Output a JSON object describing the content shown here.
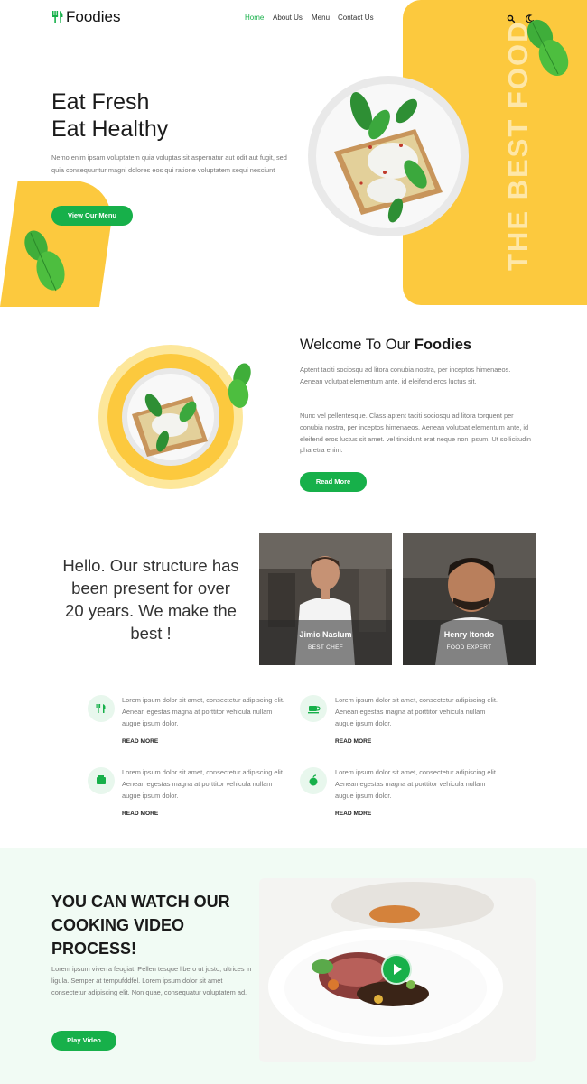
{
  "header": {
    "logo": "Foodies",
    "nav": [
      "Home",
      "About Us",
      "Menu",
      "Contact Us"
    ],
    "search_icon": "search-icon",
    "theme_icon": "moon-icon"
  },
  "hero": {
    "title_line1": "Eat Fresh",
    "title_line2": "Eat Healthy",
    "body": "Nemo enim ipsam voluptatem quia voluptas sit aspernatur aut odit aut fugit, sed quia consequuntur magni dolores eos qui ratione voluptatem sequi nesciunt",
    "button": "View Our Menu",
    "vertical_text": "THE BEST FOOD"
  },
  "welcome": {
    "title_prefix": "Welcome To Our ",
    "title_bold": "Foodies",
    "p1": "Aptent taciti sociosqu ad litora conubia nostra, per inceptos himenaeos. Aenean volutpat elementum ante, id eleifend eros luctus sit.",
    "p2": "Nunc vel pellentesque. Class aptent taciti sociosqu ad litora torquent per conubia nostra, per inceptos himenaeos. Aenean volutpat elementum ante, id eleifend eros luctus sit amet. vel tincidunt erat neque non ipsum. Ut sollicitudin pharetra enim.",
    "button": "Read More"
  },
  "about": {
    "hello": "Hello. Our structure has been present for over 20 years. We make the best !",
    "chefs": [
      {
        "name": "Jimic Naslum",
        "role": "BEST CHEF"
      },
      {
        "name": "Henry Itondo",
        "role": "FOOD EXPERT"
      }
    ]
  },
  "features": [
    {
      "icon": "utensils-icon",
      "text": "Lorem ipsum dolor sit amet, consectetur adipiscing elit. Aenean egestas magna at porttitor vehicula nullam augue ipsum dolor.",
      "link": "READ MORE"
    },
    {
      "icon": "coffee-cup-icon",
      "text": "Lorem ipsum dolor sit amet, consectetur adipiscing elit. Aenean egestas magna at porttitor vehicula nullam augue ipsum dolor.",
      "link": "READ MORE"
    },
    {
      "icon": "food-box-icon",
      "text": "Lorem ipsum dolor sit amet, consectetur adipiscing elit. Aenean egestas magna at porttitor vehicula nullam augue ipsum dolor.",
      "link": "READ MORE"
    },
    {
      "icon": "apple-icon",
      "text": "Lorem ipsum dolor sit amet, consectetur adipiscing elit. Aenean egestas magna at porttitor vehicula nullam augue ipsum dolor.",
      "link": "READ MORE"
    }
  ],
  "video": {
    "title": "YOU CAN WATCH OUR COOKING VIDEO PROCESS!",
    "body": "Lorem ipsum viverra feugiat. Pellen tesque libero ut justo, ultrices in ligula. Semper at tempufddfel. Lorem ipsum dolor sit amet consectetur adipiscing elit. Non quae, consequatur voluptatem ad.",
    "button": "Play Video"
  },
  "colors": {
    "accent_green": "#17b04a",
    "accent_yellow": "#fcc93e",
    "soft_green_bg": "#f1fbf4"
  }
}
